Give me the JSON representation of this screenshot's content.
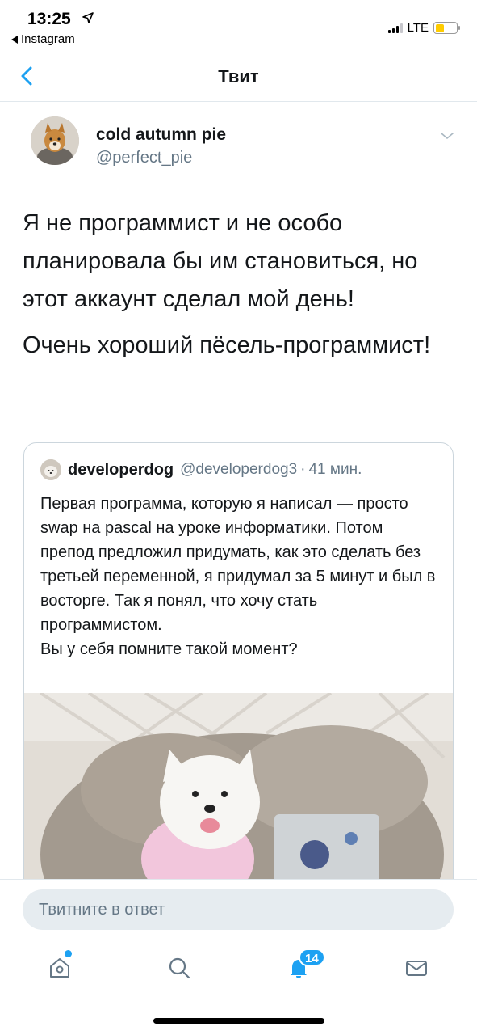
{
  "status_bar": {
    "time": "13:25",
    "back_app": "Instagram",
    "network": "LTE",
    "icons": [
      "location-arrow-icon",
      "signal-icon",
      "battery-icon"
    ]
  },
  "nav": {
    "title": "Твит",
    "back_icon": "chevron-left-icon"
  },
  "tweet": {
    "author_name": "cold autumn pie",
    "author_handle": "@perfect_pie",
    "paragraphs": [
      "Я не программист и не особо планировала бы им становиться, но этот аккаунт сделал мой день!",
      "Очень хороший пёсель-программист!"
    ]
  },
  "quoted": {
    "author_name": "developerdog",
    "author_handle": "@developerdog3",
    "separator": "·",
    "time": "41 мин.",
    "lines": [
      "Первая программа, которую я написал — просто swap на pascal на уроке информатики. Потом препод предложил придумать, как это сделать без третьей переменной, я придумал за 5 минут и был в восторге. Так я понял, что хочу стать программистом.",
      "Вы у себя помните такой момент?"
    ]
  },
  "reply": {
    "placeholder": "Твитните в ответ"
  },
  "tabbar": {
    "items": [
      "home-icon",
      "search-icon",
      "notifications-icon",
      "messages-icon"
    ],
    "notifications_badge": "14"
  },
  "colors": {
    "accent": "#1da1f2",
    "secondary_text": "#657786",
    "primary_text": "#14171a",
    "border": "#e1e8ed",
    "reply_bg": "#e6ecf0"
  }
}
